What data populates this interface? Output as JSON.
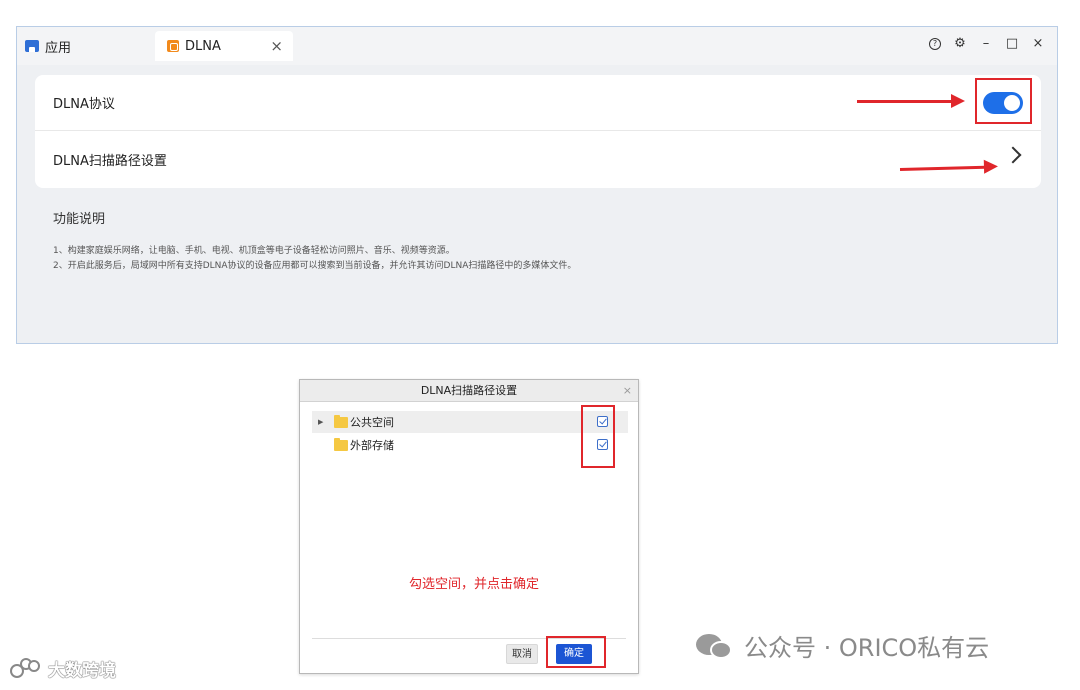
{
  "window": {
    "tabs": [
      {
        "label": "应用",
        "icon": "app-store-icon"
      },
      {
        "label": "DLNA",
        "icon": "dlna-app-icon",
        "close": "×"
      }
    ],
    "controls": {
      "help": "?",
      "settings": "⚙",
      "minimize": "–",
      "maximize": "□",
      "close": "×"
    }
  },
  "settings": {
    "dlna_protocol_label": "DLNA协议",
    "dlna_protocol_enabled": true,
    "scan_path_label": "DLNA扫描路径设置"
  },
  "description": {
    "title": "功能说明",
    "line1": "1、构建家庭娱乐网络，让电脑、手机、电视、机顶盒等电子设备轻松访问照片、音乐、视频等资源。",
    "line2": "2、开启此服务后，局域网中所有支持DLNA协议的设备应用都可以搜索到当前设备，并允许其访问DLNA扫描路径中的多媒体文件。"
  },
  "dialog": {
    "title": "DLNA扫描路径设置",
    "close": "×",
    "folders": [
      {
        "name": "公共空间",
        "checked": true,
        "expandable": true
      },
      {
        "name": "外部存储",
        "checked": true,
        "expandable": false
      }
    ],
    "annotation": "勾选空间，并点击确定",
    "cancel_label": "取消",
    "ok_label": "确定"
  },
  "watermarks": {
    "wechat_account": "公众号 · ORICO私有云",
    "brand": "大数跨境"
  },
  "colors": {
    "accent": "#1e6fe8",
    "annotation_red": "#e0262b",
    "folder": "#f5c842"
  }
}
